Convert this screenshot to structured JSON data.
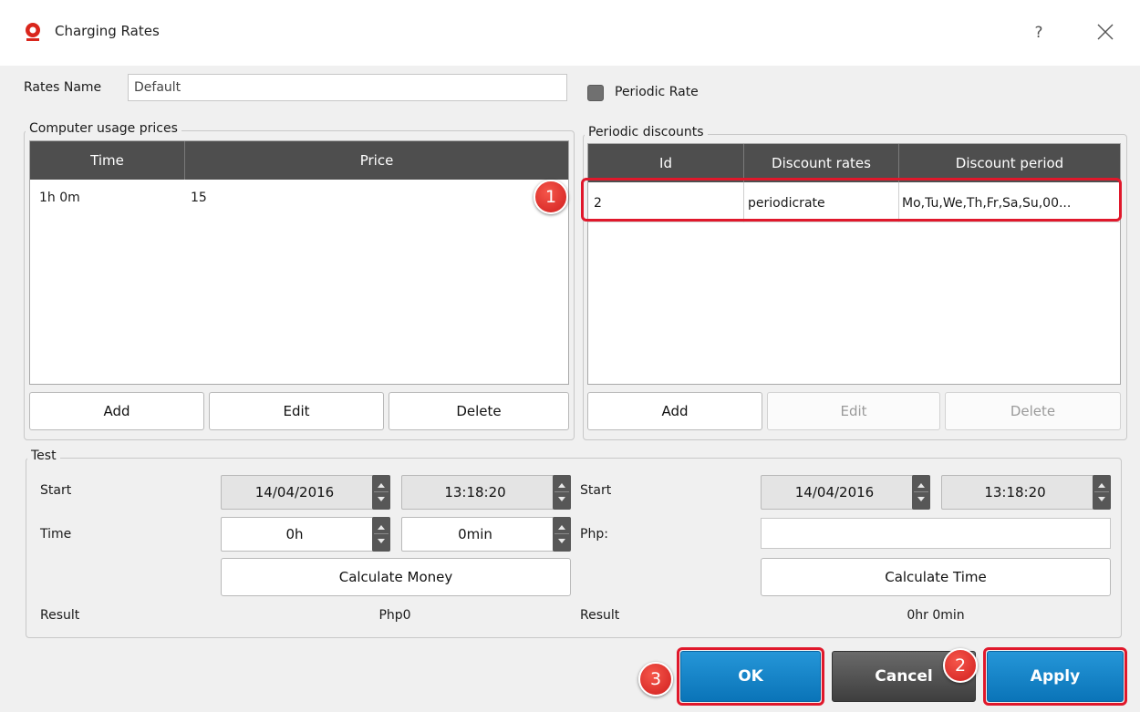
{
  "window": {
    "title": "Charging Rates",
    "help_symbol": "?",
    "app_icon": "red-gear-icon",
    "close_icon": "close-icon"
  },
  "rates_name": {
    "label": "Rates Name",
    "value": "Default"
  },
  "periodic_rate": {
    "label": "Periodic Rate",
    "checked": false
  },
  "usage_prices": {
    "title": "Computer usage prices",
    "columns": [
      "Time",
      "Price"
    ],
    "rows": [
      {
        "time": "1h 0m",
        "price": "15"
      }
    ],
    "buttons": {
      "add": "Add",
      "edit": "Edit",
      "delete": "Delete"
    }
  },
  "periodic_discounts": {
    "title": "Periodic discounts",
    "columns": [
      "Id",
      "Discount rates",
      "Discount period"
    ],
    "rows": [
      {
        "id": "2",
        "rate": "periodicrate",
        "period": "Mo,Tu,We,Th,Fr,Sa,Su,00..."
      }
    ],
    "buttons": {
      "add": "Add",
      "edit": "Edit",
      "delete": "Delete"
    },
    "edit_enabled": false,
    "delete_enabled": false
  },
  "test": {
    "title": "Test",
    "left": {
      "start_label": "Start",
      "start_date": "14/04/2016",
      "start_time": "13:18:20",
      "time_label": "Time",
      "hours": "0h",
      "minutes": "0min",
      "calc_button": "Calculate Money",
      "result_label": "Result",
      "result_value": "Php0"
    },
    "right": {
      "start_label": "Start",
      "start_date": "14/04/2016",
      "start_time": "13:18:20",
      "php_label": "Php:",
      "php_value": "",
      "calc_button": "Calculate Time",
      "result_label": "Result",
      "result_value": "0hr 0min"
    }
  },
  "footer": {
    "ok": "OK",
    "cancel": "Cancel",
    "apply": "Apply"
  },
  "annotations": {
    "badge1": "1",
    "badge2": "2",
    "badge3": "3",
    "color": "#e0182b"
  }
}
